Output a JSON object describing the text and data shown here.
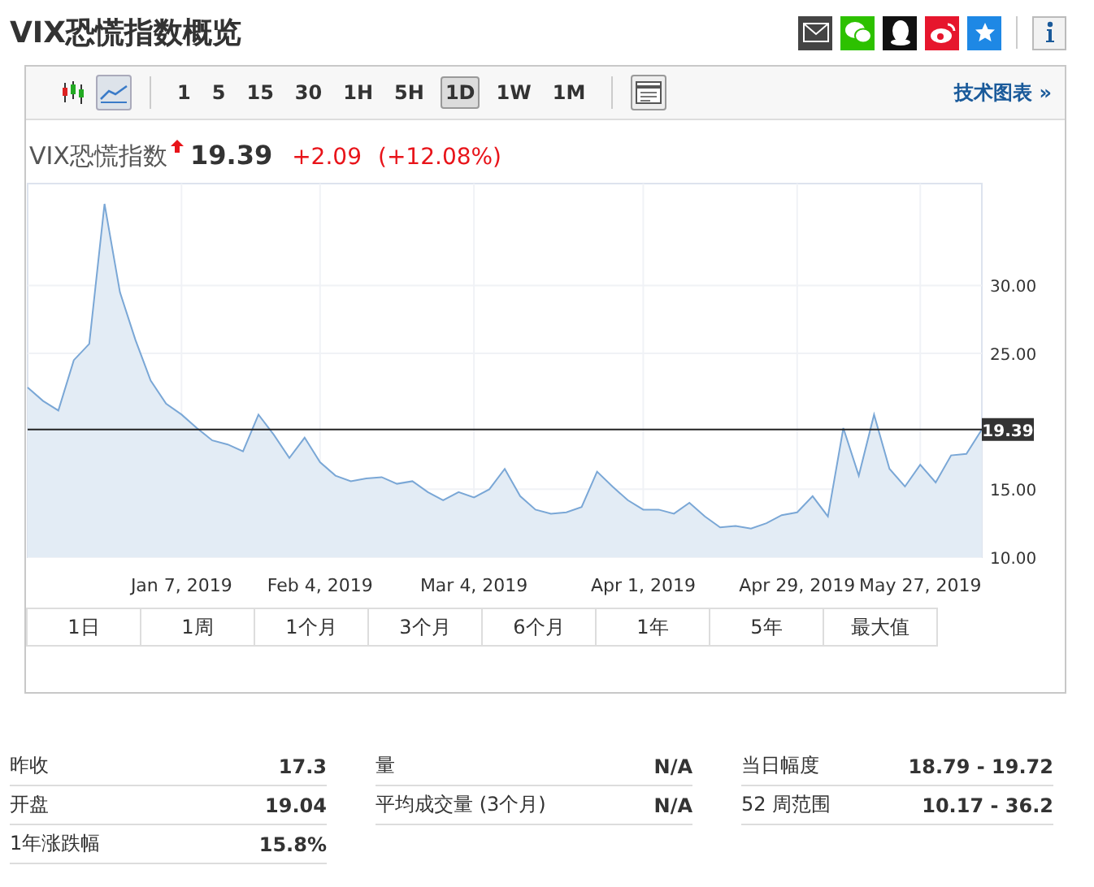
{
  "title": "VIX恐慌指数概览",
  "share_icons": [
    {
      "kind": "email",
      "color": "#444444"
    },
    {
      "kind": "wechat",
      "color": "#2dc100"
    },
    {
      "kind": "qq",
      "color": "#111111"
    },
    {
      "kind": "weibo",
      "color": "#e6162d"
    },
    {
      "kind": "favorite",
      "color": "#1e88e5"
    }
  ],
  "toolbar": {
    "chart_types": [
      {
        "kind": "candles",
        "selected": false
      },
      {
        "kind": "line",
        "selected": true
      }
    ],
    "intervals": [
      {
        "label": "1",
        "selected": false
      },
      {
        "label": "5",
        "selected": false
      },
      {
        "label": "15",
        "selected": false
      },
      {
        "label": "30",
        "selected": false
      },
      {
        "label": "1H",
        "selected": false
      },
      {
        "label": "5H",
        "selected": false
      },
      {
        "label": "1D",
        "selected": true
      },
      {
        "label": "1W",
        "selected": false
      },
      {
        "label": "1M",
        "selected": false
      }
    ],
    "link": "技术图表 »"
  },
  "quote": {
    "name": "VIX恐慌指数",
    "rising": true,
    "price": "19.39",
    "change": "+2.09",
    "change_percent": "(+12.08%)"
  },
  "chart": {
    "chart_data": {
      "type": "area",
      "grid": true,
      "ylim": [
        10,
        37.5
      ],
      "categories": [
        null,
        null,
        null,
        null,
        null,
        null,
        null,
        null,
        null,
        null,
        "Jan 7, 2019",
        null,
        null,
        null,
        null,
        null,
        null,
        null,
        null,
        "Feb 4, 2019",
        null,
        null,
        null,
        null,
        null,
        null,
        null,
        null,
        null,
        "Mar 4, 2019",
        null,
        null,
        null,
        null,
        null,
        null,
        null,
        null,
        null,
        null,
        "Apr 1, 2019",
        null,
        null,
        null,
        null,
        null,
        null,
        null,
        null,
        null,
        "Apr 29, 2019",
        null,
        null,
        null,
        null,
        null,
        null,
        null,
        "May 27, 2019",
        null,
        null,
        null,
        null
      ],
      "yticks": [
        {
          "value": 10,
          "label": "10.00"
        },
        {
          "value": 15,
          "label": "15.00"
        },
        {
          "value": 25,
          "label": "25.00"
        },
        {
          "value": 30,
          "label": "30.00"
        }
      ],
      "series": [
        {
          "color": "#7aa7d6",
          "values": [
            22.5,
            21.5,
            20.8,
            24.5,
            25.7,
            36,
            29.5,
            26,
            23,
            21.3,
            20.5,
            19.5,
            18.6,
            18.3,
            17.8,
            20.5,
            19,
            17.3,
            18.8,
            17,
            16,
            15.6,
            15.8,
            15.9,
            15.4,
            15.6,
            14.8,
            14.2,
            14.8,
            14.4,
            15,
            16.5,
            14.5,
            13.5,
            13.2,
            13.3,
            13.7,
            16.3,
            15.2,
            14.2,
            13.5,
            13.5,
            13.2,
            14,
            13,
            12.2,
            12.3,
            12.1,
            12.5,
            13.1,
            13.3,
            14.5,
            13,
            19.5,
            16,
            20.5,
            16.5,
            15.2,
            16.8,
            15.5,
            17.5,
            17.6,
            19.4
          ]
        },
        {
          "type": "line",
          "color": "#222222",
          "values": [
            19.4,
            19.4,
            19.4,
            19.4,
            19.4,
            19.4,
            19.4,
            19.4,
            19.4,
            19.4,
            19.4,
            19.4,
            19.4,
            19.4,
            19.4,
            19.4,
            19.4,
            19.4,
            19.4,
            19.4,
            19.4,
            19.4,
            19.4,
            19.4,
            19.4,
            19.4,
            19.4,
            19.4,
            19.4,
            19.4,
            19.4,
            19.4,
            19.4,
            19.4,
            19.4,
            19.4,
            19.4,
            19.4,
            19.4,
            19.4,
            19.4,
            19.4,
            19.4,
            19.4,
            19.4,
            19.4,
            19.4,
            19.4,
            19.4,
            19.4,
            19.4,
            19.4,
            19.4,
            19.4,
            19.4,
            19.4,
            19.4,
            19.4,
            19.4,
            19.4,
            19.4,
            19.4,
            19.4
          ]
        }
      ],
      "annotations": [
        {
          "y": 19.4,
          "text": "19.39"
        }
      ]
    }
  },
  "ranges": [
    {
      "label": "1日",
      "selected": false
    },
    {
      "label": "1周",
      "selected": false
    },
    {
      "label": "1个月",
      "selected": false
    },
    {
      "label": "3个月",
      "selected": false
    },
    {
      "label": "6个月",
      "selected": false
    },
    {
      "label": "1年",
      "selected": false
    },
    {
      "label": "5年",
      "selected": false
    },
    {
      "label": "最大值",
      "selected": false
    }
  ],
  "stats": [
    [
      {
        "label": "昨收",
        "value": "17.3"
      },
      {
        "label": "开盘",
        "value": "19.04"
      },
      {
        "label": "1年涨跌幅",
        "value": "15.8%"
      }
    ],
    [
      {
        "label": "量",
        "value": "N/A"
      },
      {
        "label": "平均成交量 (3个月)",
        "value": "N/A"
      }
    ],
    [
      {
        "label": "当日幅度",
        "value": "18.79 - 19.72"
      },
      {
        "label": "52 周范围",
        "value": "10.17 - 36.2"
      }
    ]
  ]
}
